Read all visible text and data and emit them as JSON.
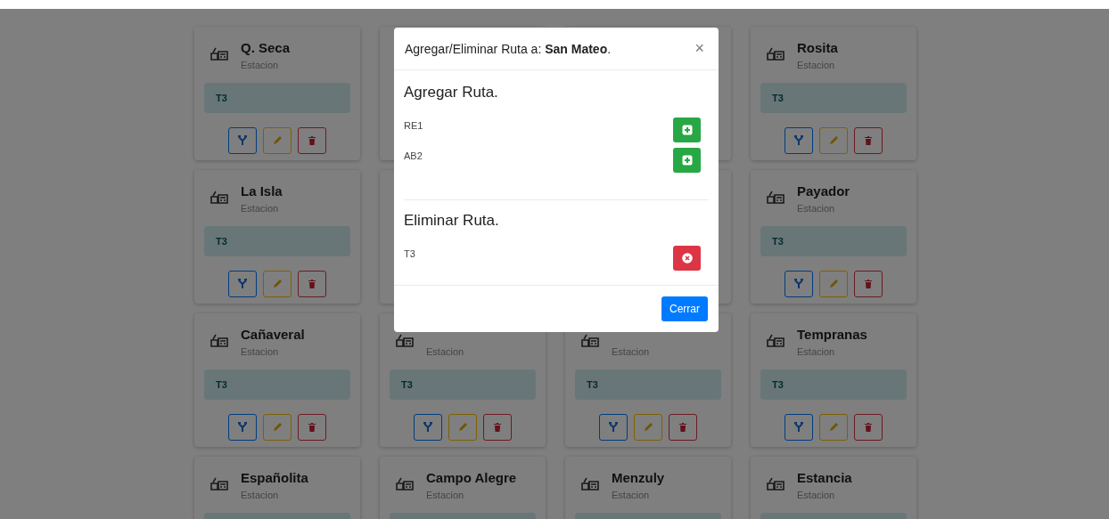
{
  "cards": [
    {
      "name": "Q. Seca",
      "subtitle": "Estacion",
      "route": "T3"
    },
    {
      "kind": "covered"
    },
    {
      "kind": "covered"
    },
    {
      "name": "Rosita",
      "subtitle": "Estacion",
      "route": "T3"
    },
    {
      "name": "La Isla",
      "subtitle": "Estacion",
      "route": "T3"
    },
    {
      "kind": "covered"
    },
    {
      "kind": "covered"
    },
    {
      "name": "Payador",
      "subtitle": "Estacion",
      "route": "T3"
    },
    {
      "name": "Cañaveral",
      "subtitle": "Estacion",
      "route": "T3"
    },
    {
      "subtitle": "Estacion",
      "route": "T3"
    },
    {
      "subtitle": "Estacion",
      "route": "T3"
    },
    {
      "name": "Tempranas",
      "subtitle": "Estacion",
      "route": "T3"
    },
    {
      "name": "Españolita",
      "subtitle": "Estacion"
    },
    {
      "name": "Campo Alegre",
      "subtitle": "Estacion"
    },
    {
      "name": "Menzuly",
      "subtitle": "Estacion"
    },
    {
      "name": "Estancia",
      "subtitle": "Estacion"
    }
  ],
  "modal": {
    "title": "Agregar/Eliminar Ruta a: **San Mateo**.",
    "close": "×",
    "sections": [
      {
        "heading": "Agregar Ruta.",
        "kind": "add",
        "routes": [
          "RE1",
          "AB2"
        ]
      },
      {
        "heading": "Eliminar Ruta.",
        "kind": "remove",
        "routes": [
          "T3"
        ]
      }
    ],
    "footer_button": "Cerrar"
  }
}
